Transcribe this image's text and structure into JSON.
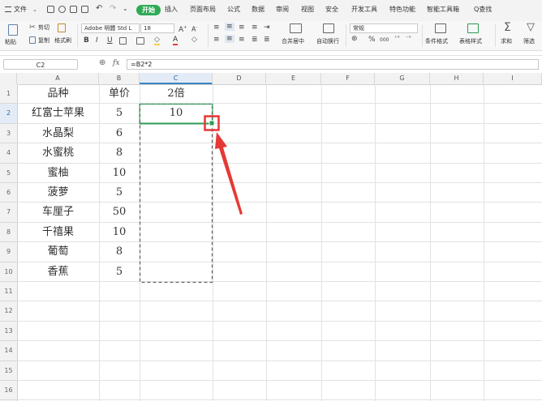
{
  "menubar": {
    "file_label": "文件",
    "tabs": [
      "开始",
      "插入",
      "页面布局",
      "公式",
      "数据",
      "审阅",
      "视图",
      "安全",
      "开发工具",
      "特色功能",
      "智能工具箱"
    ],
    "search_label": "Q查找"
  },
  "ribbon": {
    "paste_label": "粘贴",
    "cut_label": "剪切",
    "copy_label": "复制",
    "format_painter_label": "格式刷",
    "font_name": "Adobe 明體 Std L",
    "font_size": "18",
    "bold": "B",
    "italic": "I",
    "underline": "U",
    "merge_center_label": "合并居中",
    "wrap_text_label": "自动换行",
    "number_format": "常规",
    "percent": "%",
    "thousands": "000",
    "conditional_format_label": "条件格式",
    "table_style_label": "表格样式",
    "sum_label": "求和",
    "filter_label": "筛选"
  },
  "formula_bar": {
    "name_box": "C2",
    "fx_label": "fx",
    "formula": "=B2*2"
  },
  "sheet": {
    "columns": [
      "A",
      "B",
      "C",
      "D",
      "E",
      "F",
      "G",
      "H",
      "I"
    ],
    "rows": [
      "1",
      "2",
      "3",
      "4",
      "5",
      "6",
      "7",
      "8",
      "9",
      "10",
      "11",
      "12",
      "13",
      "14",
      "15",
      "16"
    ],
    "headers": {
      "a1": "品种",
      "b1": "单价",
      "c1": "2倍"
    },
    "items": [
      {
        "name": "红富士苹果",
        "price": "5"
      },
      {
        "name": "水晶梨",
        "price": "6"
      },
      {
        "name": "水蜜桃",
        "price": "8"
      },
      {
        "name": "蜜柚",
        "price": "10"
      },
      {
        "name": "菠萝",
        "price": "5"
      },
      {
        "name": "车厘子",
        "price": "50"
      },
      {
        "name": "千禧果",
        "price": "10"
      },
      {
        "name": "葡萄",
        "price": "8"
      },
      {
        "name": "香蕉",
        "price": "5"
      }
    ],
    "c2_value": "10",
    "selected_cell": "C2"
  },
  "colors": {
    "accent_green": "#2eaa57",
    "annotation_red": "#e53935",
    "selection_border": "#2e9a55"
  }
}
